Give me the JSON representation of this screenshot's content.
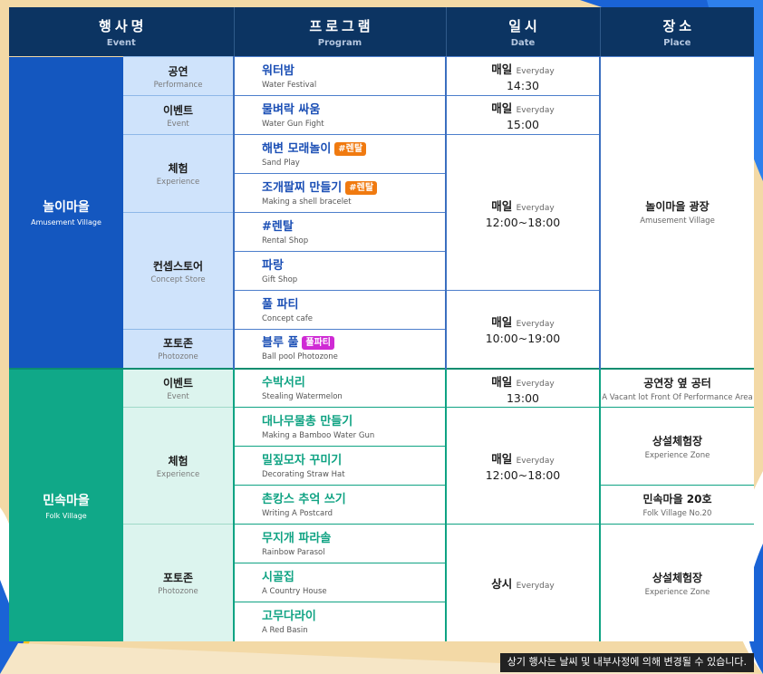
{
  "header": {
    "event": {
      "ko": "행사명",
      "en": "Event"
    },
    "program": {
      "ko": "프로그램",
      "en": "Program"
    },
    "date": {
      "ko": "일시",
      "en": "Date"
    },
    "place": {
      "ko": "장소",
      "en": "Place"
    }
  },
  "villages": [
    {
      "ko": "놀이마을",
      "en": "Amusement  Village"
    },
    {
      "ko": "민속마을",
      "en": "Folk  Village"
    }
  ],
  "categories": {
    "a_performance": {
      "ko": "공연",
      "en": "Performance"
    },
    "a_event": {
      "ko": "이벤트",
      "en": "Event"
    },
    "a_experience": {
      "ko": "체험",
      "en": "Experience"
    },
    "a_concept": {
      "ko": "컨셉스토어",
      "en": "Concept Store"
    },
    "a_photozone": {
      "ko": "포토존",
      "en": "Photozone"
    },
    "f_event": {
      "ko": "이벤트",
      "en": "Event"
    },
    "f_experience": {
      "ko": "체험",
      "en": "Experience"
    },
    "f_photozone": {
      "ko": "포토존",
      "en": "Photozone"
    }
  },
  "programs": [
    {
      "ko": "워터밤",
      "en": "Water Festival",
      "tag": ""
    },
    {
      "ko": "물벼락 싸움",
      "en": "Water Gun Fight",
      "tag": ""
    },
    {
      "ko": "해변 모래놀이",
      "en": "Sand Play",
      "tag": "#렌탈"
    },
    {
      "ko": "조개팔찌 만들기",
      "en": "Making a shell bracelet",
      "tag": "#렌탈"
    },
    {
      "ko": "#렌탈",
      "en": "Rental Shop",
      "tag": ""
    },
    {
      "ko": "파랑",
      "en": "Gift Shop",
      "tag": ""
    },
    {
      "ko": "풀 파티",
      "en": "Concept cafe",
      "tag": ""
    },
    {
      "ko": "블루 풀",
      "en": "Ball pool Photozone",
      "tag": "풀파티"
    },
    {
      "ko": "수박서리",
      "en": "Stealing Watermelon",
      "tag": ""
    },
    {
      "ko": "대나무물총 만들기",
      "en": "Making a Bamboo Water Gun",
      "tag": ""
    },
    {
      "ko": "밀짚모자 꾸미기",
      "en": "Decorating Straw Hat",
      "tag": ""
    },
    {
      "ko": "촌캉스 추억 쓰기",
      "en": "Writing A Postcard",
      "tag": ""
    },
    {
      "ko": "무지개 파라솔",
      "en": "Rainbow Parasol",
      "tag": ""
    },
    {
      "ko": "시골집",
      "en": "A Country House",
      "tag": ""
    },
    {
      "ko": "고무다라이",
      "en": "A Red Basin",
      "tag": ""
    }
  ],
  "dates": [
    {
      "day": "매일",
      "ev": "Everyday",
      "time": "14:30"
    },
    {
      "day": "매일",
      "ev": "Everyday",
      "time": "15:00"
    },
    {
      "day": "매일",
      "ev": "Everyday",
      "time": "12:00~18:00"
    },
    {
      "day": "매일",
      "ev": "Everyday",
      "time": "10:00~19:00"
    },
    {
      "day": "매일",
      "ev": "Everyday",
      "time": "13:00"
    },
    {
      "day": "매일",
      "ev": "Everyday",
      "time": "12:00~18:00"
    },
    {
      "day": "상시",
      "ev": "Everyday",
      "time": ""
    }
  ],
  "places": [
    {
      "ko": "놀이마을 광장",
      "en": "Amusement Village"
    },
    {
      "ko": "공연장 옆 공터",
      "en": "A Vacant lot Front Of Performance Area"
    },
    {
      "ko": "상설체험장",
      "en": "Experience Zone"
    },
    {
      "ko": "민속마을 20호",
      "en": "Folk Village No.20"
    },
    {
      "ko": "상설체험장",
      "en": "Experience Zone"
    }
  ],
  "notice": "상기 행사는 날씨 및 내부사정에 의해 변경될 수 있습니다.",
  "colors": {
    "header_bg": "#0c3462",
    "amusement_blue": "#1457bf",
    "folk_green": "#10a888",
    "tag_orange": "#f07a10",
    "tag_magenta": "#cf2ad4"
  }
}
